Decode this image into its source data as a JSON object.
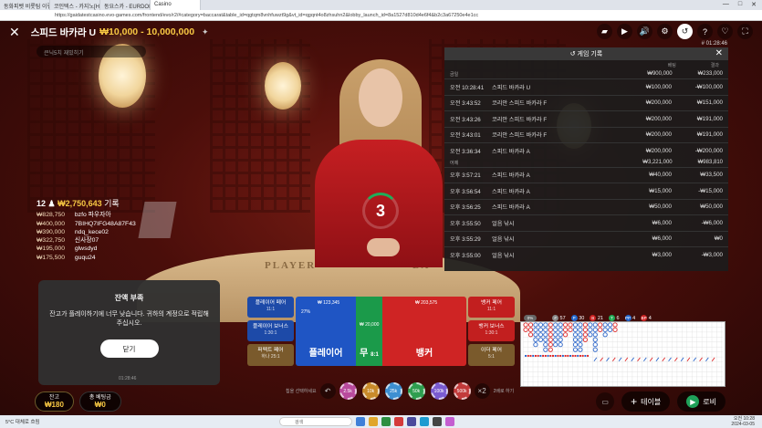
{
  "browser": {
    "tabs": [
      "동화피벳 비롯팀 이렇던...",
      "코인텍스 - 카지노[HDSL 업...",
      "동요스카 - EURDOM. 알아보...",
      "Casino"
    ],
    "url": "https://gaidatestcasino.evo-games.com/frontend/evo/r2/#category=baccarat&table_id=qgtqm8vnhfuwzt9g&vt_id=qgqnt4o8zhsuhn2&lobby_launch_id=8a1527d810d4e6f4&b2c3a67250e4e1cc",
    "window_controls": [
      "—",
      "□",
      "✕"
    ]
  },
  "topbar": {
    "close_icon": "✕",
    "title": "스피드 바카라 U",
    "limit": "₩10,000 - 10,000,000",
    "pin_icon": "pin-icon",
    "game_id": "# 01:28:46",
    "icons": [
      {
        "name": "chat-icon",
        "glyph": "▰"
      },
      {
        "name": "video-icon",
        "glyph": "▶"
      },
      {
        "name": "sound-icon",
        "glyph": "🔊"
      },
      {
        "name": "settings-icon",
        "glyph": "⚙"
      },
      {
        "name": "history-icon",
        "glyph": "↺"
      },
      {
        "name": "help-icon",
        "glyph": "?"
      },
      {
        "name": "favorite-icon",
        "glyph": "♡"
      },
      {
        "name": "fullscreen-icon",
        "glyph": "⛶"
      }
    ]
  },
  "chat": {
    "placeholder": "큰닉5치 재밌히기"
  },
  "history": {
    "title": "게임 기록",
    "col_bet": "베팅",
    "col_payout": "결과",
    "sections": [
      {
        "label": "금일",
        "total_bet": "₩900,000",
        "total_payout": "₩233,000",
        "rows": [
          {
            "time": "오전 10:28:41",
            "game": "스피드 바카라 U",
            "bet": "₩100,000",
            "payout": "-₩100,000"
          },
          {
            "time": "오전 3:43:52",
            "game": "코리안 스피드 바카라 F",
            "bet": "₩200,000",
            "payout": "₩151,000"
          },
          {
            "time": "오전 3:43:26",
            "game": "코리안 스피드 바카라 F",
            "bet": "₩200,000",
            "payout": "₩191,000"
          },
          {
            "time": "오전 3:43:01",
            "game": "코리안 스피드 바카라 F",
            "bet": "₩200,000",
            "payout": "₩191,000"
          },
          {
            "time": "오전 3:36:34",
            "game": "스피드 바카라 A",
            "bet": "₩200,000",
            "payout": "-₩200,000"
          }
        ]
      },
      {
        "label": "어제",
        "total_bet": "₩3,221,000",
        "total_payout": "₩983,810",
        "rows": [
          {
            "time": "오후 3:57:21",
            "game": "스피드 바카라 A",
            "bet": "₩40,000",
            "payout": "₩33,500"
          },
          {
            "time": "오후 3:56:54",
            "game": "스피드 바카라 A",
            "bet": "₩15,000",
            "payout": "-₩15,000"
          },
          {
            "time": "오후 3:56:25",
            "game": "스피드 바카라 A",
            "bet": "₩50,000",
            "payout": "₩50,000"
          },
          {
            "time": "오후 3:55:50",
            "game": "얼음 낚시",
            "bet": "₩6,000",
            "payout": "-₩6,000"
          },
          {
            "time": "오후 3:55:29",
            "game": "얼음 낚시",
            "bet": "₩6,000",
            "payout": "₩0"
          },
          {
            "time": "오후 3:55:00",
            "game": "얼음 낚시",
            "bet": "₩3,000",
            "payout": "-₩3,000"
          }
        ]
      }
    ]
  },
  "countdown": "3",
  "players": {
    "count": "12",
    "total": "₩2,750,643",
    "suffix": "기록",
    "list": [
      {
        "amount": "₩828,750",
        "name": "bzfo 파우자아"
      },
      {
        "amount": "₩400,000",
        "name": "7BIHQ7IFG48A87F43"
      },
      {
        "amount": "₩390,000",
        "name": "ndq_kece02"
      },
      {
        "amount": "₩322,750",
        "name": "신사장07"
      },
      {
        "amount": "₩195,000",
        "name": "glwsdyd"
      },
      {
        "amount": "₩175,500",
        "name": "guqu24"
      }
    ]
  },
  "table_felt": {
    "player": "PLAYER",
    "banker": "BA"
  },
  "modal": {
    "title": "잔액 부족",
    "message": "잔고가 플레이하기에 너무 낮습니다. 귀하의 계정으로 적립해 주십시오.",
    "button": "닫기"
  },
  "stream_time": "01:28:46",
  "bets": {
    "player_pair": {
      "label": "플레이어 페어",
      "odds": "11:1"
    },
    "player_bonus": {
      "label": "플레이어 보너스",
      "odds": "1:30:1"
    },
    "perfect_pair": {
      "label": "퍼펙트 페어",
      "odds": "하나 25:1"
    },
    "player": {
      "label": "플레이어",
      "stat": "₩ 123,345",
      "pct": "27%",
      "count": "12"
    },
    "tie": {
      "label": "무",
      "odds": "8:1",
      "stat": "₩ 20,000",
      "count": "1"
    },
    "banker": {
      "label": "뱅커",
      "stat": "₩ 203,575",
      "count": "7"
    },
    "banker_pair": {
      "label": "뱅커 페어",
      "odds": "11:1"
    },
    "banker_bonus": {
      "label": "뱅커 보너스",
      "odds": "1:30:1"
    },
    "either_pair": {
      "label": "이더 페어",
      "odds": "5:1"
    }
  },
  "chips": {
    "left_label": "칩을 선택하세요",
    "right_label": "2배로 하기",
    "values": [
      "2.5k",
      "10k",
      "25k",
      "50k",
      "100k",
      "500k"
    ],
    "colors": [
      "#b94a9c",
      "#c98a2a",
      "#3d8fd1",
      "#2e9e4f",
      "#7a5bd0",
      "#c23a3a"
    ]
  },
  "road": {
    "pct": "0%",
    "stats": [
      {
        "label": "#",
        "value": "57",
        "color": "#888"
      },
      {
        "label": "P",
        "value": "30",
        "color": "#2266cc"
      },
      {
        "label": "B",
        "value": "21",
        "color": "#cc2222"
      },
      {
        "label": "T",
        "value": "6",
        "color": "#22aa55"
      },
      {
        "label": "PP",
        "value": "4",
        "color": "#2266cc"
      },
      {
        "label": "BP",
        "value": "4",
        "color": "#cc2222"
      }
    ]
  },
  "balance": {
    "label": "잔고",
    "value": "₩180",
    "bet_label": "총 베팅금",
    "bet_value": "₩0"
  },
  "nav": {
    "table": "테이블",
    "lobby": "로비",
    "plus_icon": "+",
    "lobby_icon": "▶"
  },
  "taskbar": {
    "weather": "5°C",
    "weather_desc": "대체로 흐림",
    "search": "검색",
    "time": "오전 10:28",
    "date": "2024-03-05",
    "icon_colors": [
      "#3f7fd8",
      "#e0a62c",
      "#2d8f42",
      "#d43b3b",
      "#4a4a9c",
      "#1d9bd1",
      "#444",
      "#c45dd0"
    ]
  }
}
